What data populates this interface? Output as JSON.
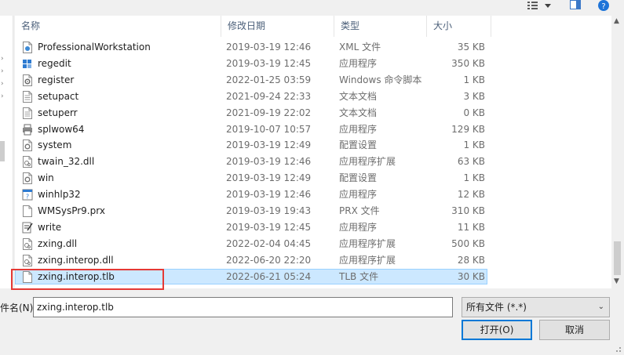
{
  "toolbar": {
    "view_icon": "details-view-icon",
    "view_dropdown_icon": "chevron-down-icon",
    "preview_pane_icon": "preview-pane-icon",
    "help_icon": "help-icon"
  },
  "columns": {
    "name": "名称",
    "date": "修改日期",
    "type": "类型",
    "size": "大小"
  },
  "files": [
    {
      "name": "ProfessionalWorkstation",
      "date": "2019-03-19 12:46",
      "type": "XML 文件",
      "size": "35 KB",
      "icon": "xml-file-icon"
    },
    {
      "name": "regedit",
      "date": "2019-03-19 12:45",
      "type": "应用程序",
      "size": "350 KB",
      "icon": "regedit-app-icon"
    },
    {
      "name": "register",
      "date": "2022-01-25 03:59",
      "type": "Windows 命令脚本",
      "size": "1 KB",
      "icon": "script-file-icon"
    },
    {
      "name": "setupact",
      "date": "2021-09-24 22:33",
      "type": "文本文档",
      "size": "3 KB",
      "icon": "text-file-icon"
    },
    {
      "name": "setuperr",
      "date": "2021-09-19 22:02",
      "type": "文本文档",
      "size": "0 KB",
      "icon": "text-file-icon"
    },
    {
      "name": "splwow64",
      "date": "2019-10-07 10:57",
      "type": "应用程序",
      "size": "129 KB",
      "icon": "printer-app-icon"
    },
    {
      "name": "system",
      "date": "2019-03-19 12:49",
      "type": "配置设置",
      "size": "1 KB",
      "icon": "config-file-icon"
    },
    {
      "name": "twain_32.dll",
      "date": "2019-03-19 12:46",
      "type": "应用程序扩展",
      "size": "63 KB",
      "icon": "dll-file-icon"
    },
    {
      "name": "win",
      "date": "2019-03-19 12:49",
      "type": "配置设置",
      "size": "1 KB",
      "icon": "config-file-icon"
    },
    {
      "name": "winhlp32",
      "date": "2019-03-19 12:46",
      "type": "应用程序",
      "size": "12 KB",
      "icon": "help-app-icon"
    },
    {
      "name": "WMSysPr9.prx",
      "date": "2019-03-19 19:43",
      "type": "PRX 文件",
      "size": "310 KB",
      "icon": "blank-file-icon"
    },
    {
      "name": "write",
      "date": "2019-03-19 12:45",
      "type": "应用程序",
      "size": "11 KB",
      "icon": "write-app-icon"
    },
    {
      "name": "zxing.dll",
      "date": "2022-02-04 04:45",
      "type": "应用程序扩展",
      "size": "500 KB",
      "icon": "dll-file-icon"
    },
    {
      "name": "zxing.interop.dll",
      "date": "2022-06-20 22:20",
      "type": "应用程序扩展",
      "size": "28 KB",
      "icon": "dll-file-icon"
    },
    {
      "name": "zxing.interop.tlb",
      "date": "2022-06-21 05:24",
      "type": "TLB 文件",
      "size": "30 KB",
      "icon": "blank-file-icon",
      "selected": true
    }
  ],
  "filename": {
    "label": "件名(N):",
    "value": "zxing.interop.tlb"
  },
  "filetype": {
    "selected": "所有文件 (*.*)"
  },
  "buttons": {
    "open": "打开(O)",
    "cancel": "取消"
  },
  "colors": {
    "selection_bg": "#cce8ff",
    "selection_border": "#99d1ff",
    "annotation_box": "#e53935",
    "header_text": "#4c607a"
  }
}
